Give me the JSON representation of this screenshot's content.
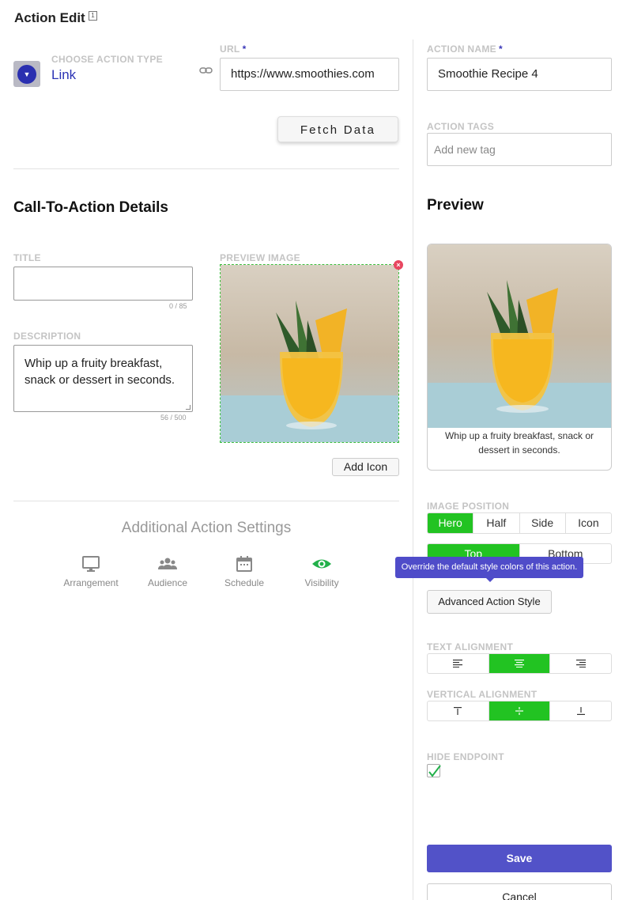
{
  "header": {
    "title": "Action Edit",
    "info_badge": "1"
  },
  "action_type": {
    "label": "CHOOSE ACTION TYPE",
    "value": "Link"
  },
  "url": {
    "label": "URL",
    "required": "*",
    "value": "https://www.smoothies.com"
  },
  "fetch_button": "Fetch Data",
  "cta": {
    "section_title": "Call-To-Action Details",
    "title_label": "TITLE",
    "title_value": "",
    "title_counter": "0 / 85",
    "description_label": "DESCRIPTION",
    "description_value": "Whip up a fruity breakfast, snack or dessert in seconds.",
    "description_counter": "56 / 500",
    "preview_image_label": "PREVIEW IMAGE",
    "add_icon_button": "Add Icon"
  },
  "additional_settings": {
    "title": "Additional Action Settings",
    "items": [
      {
        "label": "Arrangement",
        "icon": "monitor-icon"
      },
      {
        "label": "Audience",
        "icon": "users-icon"
      },
      {
        "label": "Schedule",
        "icon": "calendar-icon"
      },
      {
        "label": "Visibility",
        "icon": "eye-icon"
      }
    ]
  },
  "action_name": {
    "label": "ACTION NAME",
    "required": "*",
    "value": "Smoothie Recipe 4"
  },
  "action_tags": {
    "label": "ACTION TAGS",
    "placeholder": "Add new tag"
  },
  "preview": {
    "title": "Preview",
    "caption": "Whip up a fruity breakfast, snack or dessert in seconds."
  },
  "image_position": {
    "label": "IMAGE POSITION",
    "options": [
      "Hero",
      "Half",
      "Side",
      "Icon"
    ],
    "selected": "Hero",
    "vertical_options": [
      "Top",
      "Bottom"
    ],
    "vertical_selected": "Top"
  },
  "tooltip": "Override the default style colors of this action.",
  "advanced_style_button": "Advanced Action Style",
  "text_alignment": {
    "label": "TEXT ALIGNMENT",
    "selected": "center"
  },
  "vertical_alignment": {
    "label": "VERTICAL ALIGNMENT",
    "selected": "middle"
  },
  "hide_endpoint": {
    "label": "HIDE ENDPOINT",
    "checked": true
  },
  "buttons": {
    "save": "Save",
    "cancel": "Cancel"
  },
  "colors": {
    "accent_green": "#22c322",
    "primary_purple": "#5252c8",
    "link_blue": "#2b33b5",
    "tooltip": "#4f4cc9",
    "error_red": "#e84660"
  }
}
